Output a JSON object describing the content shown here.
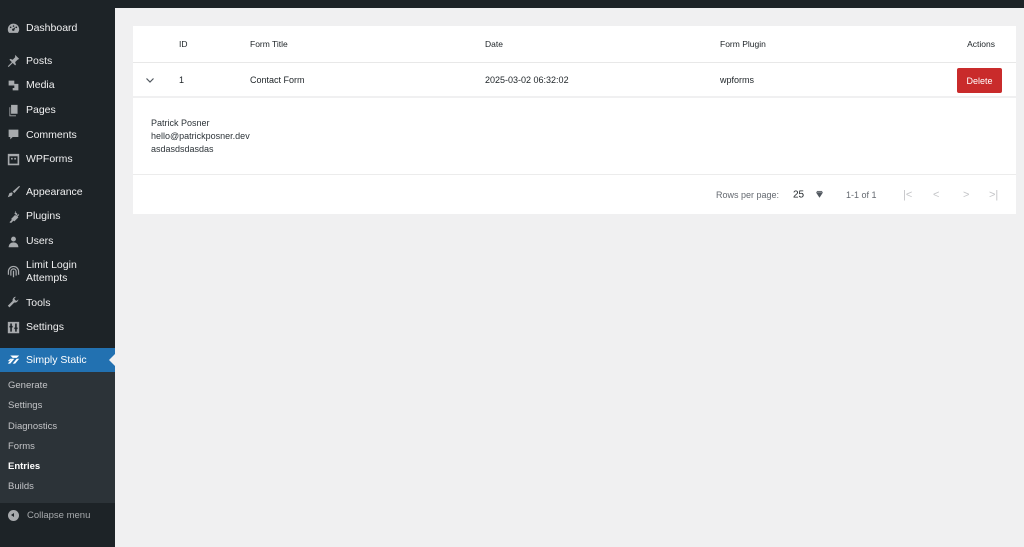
{
  "sidebar": {
    "items": [
      {
        "label": "Dashboard",
        "icon": "dashboard-icon"
      },
      {
        "label": "Posts",
        "icon": "pin-icon"
      },
      {
        "label": "Media",
        "icon": "media-icon"
      },
      {
        "label": "Pages",
        "icon": "pages-icon"
      },
      {
        "label": "Comments",
        "icon": "comment-icon"
      },
      {
        "label": "WPForms",
        "icon": "wpforms-icon"
      },
      {
        "label": "Appearance",
        "icon": "brush-icon"
      },
      {
        "label": "Plugins",
        "icon": "plug-icon"
      },
      {
        "label": "Users",
        "icon": "user-icon"
      },
      {
        "label": "Limit Login Attempts",
        "icon": "fingerprint-icon"
      },
      {
        "label": "Tools",
        "icon": "wrench-icon"
      },
      {
        "label": "Settings",
        "icon": "sliders-icon"
      },
      {
        "label": "Simply Static",
        "icon": "simply-static-icon"
      }
    ],
    "submenu": [
      "Generate",
      "Settings",
      "Diagnostics",
      "Forms",
      "Entries",
      "Builds"
    ],
    "current_submenu": "Entries",
    "collapse_label": "Collapse menu",
    "active_color": "#2271b1"
  },
  "table": {
    "columns": {
      "id": "ID",
      "title": "Form Title",
      "date": "Date",
      "plugin": "Form Plugin",
      "actions": "Actions"
    },
    "rows": [
      {
        "id": "1",
        "title": "Contact Form",
        "date": "2025-03-02 06:32:02",
        "plugin": "wpforms",
        "action_label": "Delete",
        "expanded": true,
        "details": [
          "Patrick Posner",
          "hello@patrickposner.dev",
          "asdasdsdasdas"
        ]
      }
    ],
    "delete_color": "#c92b2b"
  },
  "pagination": {
    "rows_per_page_label": "Rows per page:",
    "rows_per_page_value": "25",
    "range": "1-1 of 1",
    "first": "|<",
    "prev": "<",
    "next": ">",
    "last": ">|"
  }
}
